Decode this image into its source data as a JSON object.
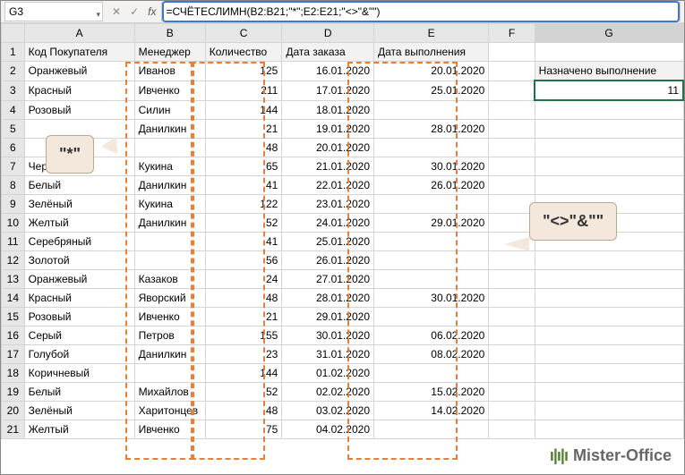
{
  "name_box": "G3",
  "formula": "=СЧЁТЕСЛИМН(B2:B21;\"*\";E2:E21;\"<>\"&\"\")",
  "fx": "fx",
  "check": "✓",
  "x": "✕",
  "dd": "▾",
  "columns": [
    "A",
    "B",
    "C",
    "D",
    "E",
    "F",
    "G"
  ],
  "headers": {
    "A": "Код Покупателя",
    "B": "Менеджер",
    "C": "Количество",
    "D": "Дата заказа",
    "E": "Дата выполнения"
  },
  "side_label": "Назначено выполнение",
  "result": "11",
  "rows": [
    {
      "n": 2,
      "a": "Оранжевый",
      "b": "Иванов",
      "c": "125",
      "d": "16.01.2020",
      "e": "20.01.2020"
    },
    {
      "n": 3,
      "a": "Красный",
      "b": "Ивченко",
      "c": "211",
      "d": "17.01.2020",
      "e": "25.01.2020"
    },
    {
      "n": 4,
      "a": "Розовый",
      "b": "Силин",
      "c": "144",
      "d": "18.01.2020",
      "e": ""
    },
    {
      "n": 5,
      "a": "",
      "b": "Данилкин",
      "c": "21",
      "d": "19.01.2020",
      "e": "28.01.2020"
    },
    {
      "n": 6,
      "a": "",
      "b": "",
      "c": "48",
      "d": "20.01.2020",
      "e": ""
    },
    {
      "n": 7,
      "a": "Черный",
      "b": "Кукина",
      "c": "65",
      "d": "21.01.2020",
      "e": "30.01.2020"
    },
    {
      "n": 8,
      "a": "Белый",
      "b": "Данилкин",
      "c": "41",
      "d": "22.01.2020",
      "e": "26.01.2020"
    },
    {
      "n": 9,
      "a": "Зелёный",
      "b": "Кукина",
      "c": "122",
      "d": "23.01.2020",
      "e": ""
    },
    {
      "n": 10,
      "a": "Желтый",
      "b": "Данилкин",
      "c": "52",
      "d": "24.01.2020",
      "e": "29.01.2020"
    },
    {
      "n": 11,
      "a": "Серебряный",
      "b": "",
      "c": "41",
      "d": "25.01.2020",
      "e": ""
    },
    {
      "n": 12,
      "a": "Золотой",
      "b": "",
      "c": "56",
      "d": "26.01.2020",
      "e": ""
    },
    {
      "n": 13,
      "a": "Оранжевый",
      "b": "Казаков",
      "c": "24",
      "d": "27.01.2020",
      "e": ""
    },
    {
      "n": 14,
      "a": "Красный",
      "b": "Яворский",
      "c": "48",
      "d": "28.01.2020",
      "e": "30.01.2020"
    },
    {
      "n": 15,
      "a": "Розовый",
      "b": "Ивченко",
      "c": "21",
      "d": "29.01.2020",
      "e": ""
    },
    {
      "n": 16,
      "a": "Серый",
      "b": "Петров",
      "c": "155",
      "d": "30.01.2020",
      "e": "06.02.2020"
    },
    {
      "n": 17,
      "a": "Голубой",
      "b": "Данилкин",
      "c": "23",
      "d": "31.01.2020",
      "e": "08.02.2020"
    },
    {
      "n": 18,
      "a": "Коричневый",
      "b": "",
      "c": "144",
      "d": "01.02.2020",
      "e": ""
    },
    {
      "n": 19,
      "a": "Белый",
      "b": "Михайлов",
      "c": "52",
      "d": "02.02.2020",
      "e": "15.02.2020"
    },
    {
      "n": 20,
      "a": "Зелёный",
      "b": "Харитонцев",
      "c": "48",
      "d": "03.02.2020",
      "e": "14.02.2020"
    },
    {
      "n": 21,
      "a": "Желтый",
      "b": "Ивченко",
      "c": "75",
      "d": "04.02.2020",
      "e": ""
    }
  ],
  "callout1": "\"*\"",
  "callout2": "\"<>\"&\"\"",
  "watermark": "Mister-Office"
}
